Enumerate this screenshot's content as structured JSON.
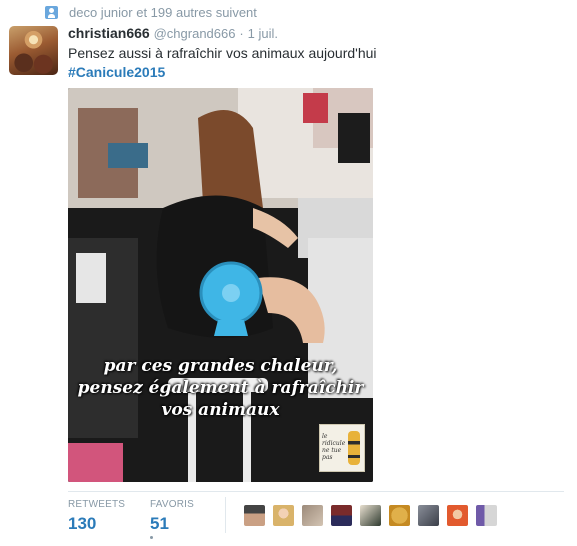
{
  "context": {
    "icon": "retweet-follow-user-icon",
    "text": "deco junior et 199 autres suivent"
  },
  "tweet": {
    "author_name": "christian666",
    "author_handle": "@chgrand666",
    "separator": "·",
    "timestamp": "1 juil.",
    "text": "Pensez aussi à rafraîchir vos animaux aujourd'hui",
    "hashtag": "#Canicule2015",
    "image_caption_lines": [
      "par ces grandes chaleur,",
      "pensez également à rafraîchir",
      "vos animaux"
    ],
    "watermark_text": "le ridicule ne tue pas"
  },
  "stats": {
    "retweets_label": "RETWEETS",
    "retweets_value": "130",
    "favorites_label": "FAVORIS",
    "favorites_value": "51"
  },
  "colors": {
    "link": "#2b7bb9",
    "muted": "#8899a6",
    "text": "#292f33",
    "fan": "#3fb6e6"
  },
  "facepile_count": 9
}
